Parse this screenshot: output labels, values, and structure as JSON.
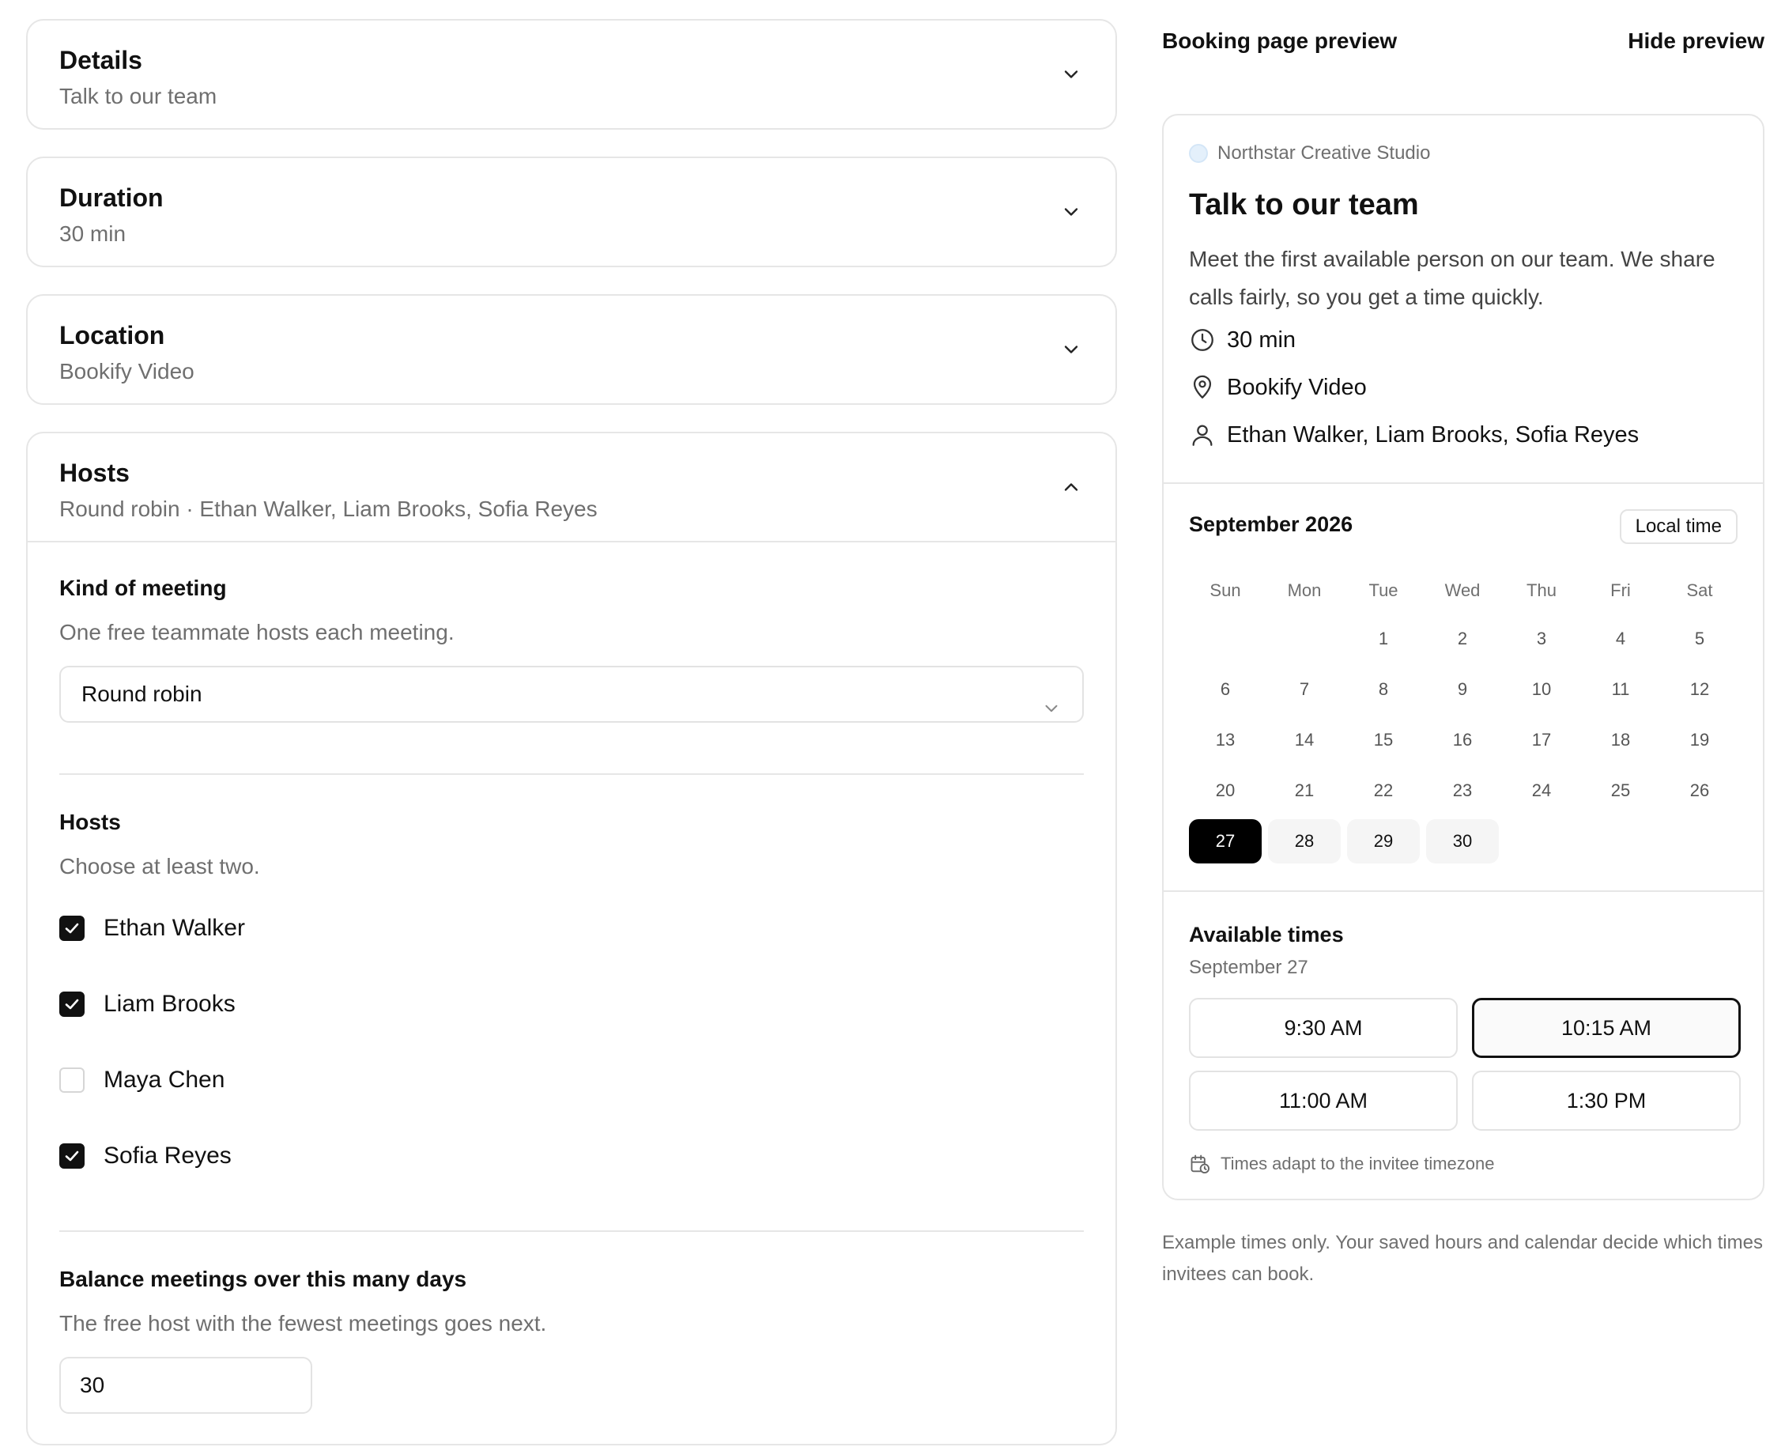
{
  "sections": {
    "details": {
      "title": "Details",
      "summary": "Talk to our team"
    },
    "duration": {
      "title": "Duration",
      "summary": "30 min"
    },
    "location": {
      "title": "Location",
      "summary": "Bookify Video"
    },
    "hosts": {
      "title": "Hosts",
      "summary": "Round robin · Ethan Walker, Liam Brooks, Sofia Reyes",
      "kind_title": "Kind of meeting",
      "kind_desc": "One free teammate hosts each meeting.",
      "kind_value": "Round robin",
      "hosts_title": "Hosts",
      "hosts_desc": "Choose at least two.",
      "members": [
        {
          "name": "Ethan Walker",
          "checked": true
        },
        {
          "name": "Liam Brooks",
          "checked": true
        },
        {
          "name": "Maya Chen",
          "checked": false
        },
        {
          "name": "Sofia Reyes",
          "checked": true
        }
      ],
      "balance_title": "Balance meetings over this many days",
      "balance_desc": "The free host with the fewest meetings goes next.",
      "balance_value": "30"
    }
  },
  "preview": {
    "header_title": "Booking page preview",
    "hide_label": "Hide preview",
    "org_name": "Northstar Creative Studio",
    "event_title": "Talk to our team",
    "description": "Meet the first available person on our team. We share calls fairly, so you get a time quickly.",
    "meta": {
      "duration": "30 min",
      "location": "Bookify Video",
      "hosts": "Ethan Walker, Liam Brooks, Sofia Reyes"
    },
    "calendar": {
      "month": "September 2026",
      "tz_label": "Local time",
      "weekdays": [
        "Sun",
        "Mon",
        "Tue",
        "Wed",
        "Thu",
        "Fri",
        "Sat"
      ],
      "leading_blanks": 2,
      "days": [
        "1",
        "2",
        "3",
        "4",
        "5",
        "6",
        "7",
        "8",
        "9",
        "10",
        "11",
        "12",
        "13",
        "14",
        "15",
        "16",
        "17",
        "18",
        "19",
        "20",
        "21",
        "22",
        "23",
        "24",
        "25",
        "26",
        "27",
        "28",
        "29",
        "30"
      ],
      "selected_day": "27",
      "available_days": [
        "28",
        "29",
        "30"
      ]
    },
    "times": {
      "title": "Available times",
      "date": "September 27",
      "slots": [
        "9:30 AM",
        "10:15 AM",
        "11:00 AM",
        "1:30 PM"
      ],
      "active_slot": "10:15 AM",
      "note": "Times adapt to the invitee timezone"
    },
    "footnote": "Example times only. Your saved hours and calendar decide which times invitees can book."
  },
  "icons": {
    "chevron": "chevron-down-icon",
    "clock": "clock-icon",
    "location": "map-pin-icon",
    "person": "person-icon",
    "calendar": "calendar-clock-icon",
    "check": "check-icon"
  }
}
